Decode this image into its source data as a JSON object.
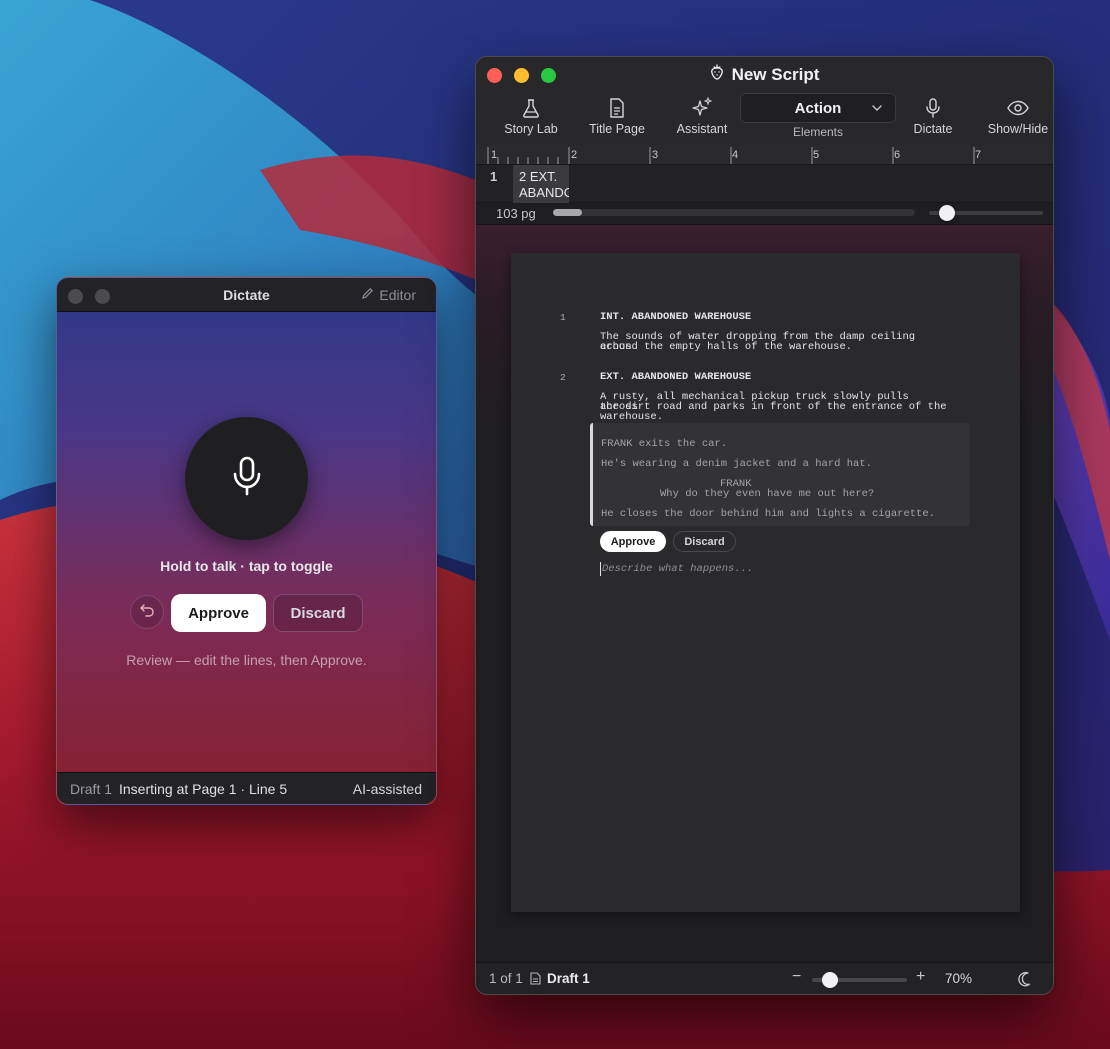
{
  "colors": {
    "close": "#fe5f57",
    "minimize": "#febc2e",
    "zoom": "#28c840",
    "accent": "#ffffff"
  },
  "dictate_window": {
    "title": "Dictate",
    "editor_label": "Editor",
    "hint": "Hold to talk · tap to toggle",
    "approve_label": "Approve",
    "discard_label": "Discard",
    "review_text": "Review — edit the lines, then Approve.",
    "status": {
      "draft": "Draft 1",
      "inserting": "Inserting at Page 1 · Line 5",
      "ai": "AI-assisted"
    },
    "icons": [
      "mic-icon",
      "undo-icon",
      "pencil-icon"
    ]
  },
  "main_window": {
    "title": "New Script",
    "toolbar": {
      "story_lab": "Story Lab",
      "title_page": "Title Page",
      "assistant": "Assistant",
      "element_value": "Action",
      "elements_label": "Elements",
      "dictate": "Dictate",
      "show_hide": "Show/Hide"
    },
    "ruler": [
      "1",
      "2",
      "3",
      "4",
      "5",
      "6",
      "7"
    ],
    "scene_strip": {
      "number": "1",
      "chip_line1": "2 EXT.",
      "chip_line2": "ABANDONED"
    },
    "page_strip": {
      "count": "103 pg",
      "progress_fraction": 0.08,
      "slider_fraction": 0.16
    },
    "script": {
      "scene1_no": "1",
      "scene1_heading": "INT. ABANDONED WAREHOUSE",
      "scene1_action_1": "The sounds of water dropping from the damp ceiling echos",
      "scene1_action_2": "around the empty halls of the warehouse.",
      "scene2_no": "2",
      "scene2_heading": "EXT. ABANDONED WAREHOUSE",
      "scene2_action_1": "A rusty, all mechanical pickup truck slowly pulls across",
      "scene2_action_2": "the dirt road and parks in front of the entrance of the",
      "scene2_action_3": "warehouse.",
      "pending": {
        "line1": "FRANK exits the car.",
        "line2": "He's wearing a denim jacket and a hard hat.",
        "character": "FRANK",
        "dialogue": "Why do they even have me out here?",
        "line3": "He closes the door behind him and lights a cigarette."
      },
      "approve_label": "Approve",
      "discard_label": "Discard",
      "describe_placeholder": "Describe what happens..."
    },
    "statusbar": {
      "pages": "1 of 1",
      "draft": "Draft 1",
      "minus": "−",
      "plus": "+",
      "zoom_fraction": 0.19,
      "zoom": "70%"
    }
  }
}
